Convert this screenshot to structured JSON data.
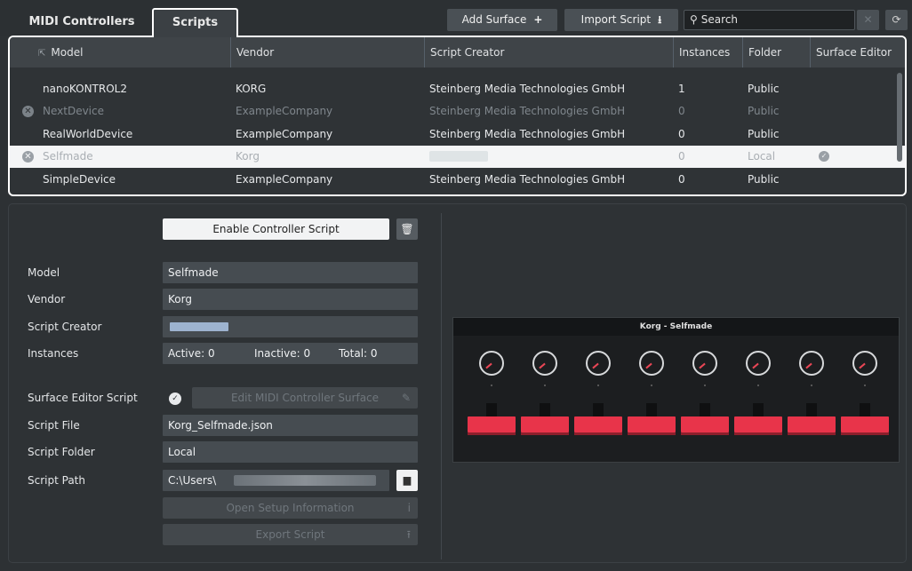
{
  "tabs": [
    {
      "label": "MIDI Controllers",
      "active": false
    },
    {
      "label": "Scripts",
      "active": true
    }
  ],
  "toolbar": {
    "add_surface": "Add Surface",
    "add_surface_icon": "+",
    "import_script": "Import Script",
    "search_placeholder": "Search"
  },
  "table": {
    "columns": [
      "Model",
      "Vendor",
      "Script Creator",
      "Instances",
      "Folder",
      "Surface Editor"
    ],
    "rows": [
      {
        "model": "nanoKONTROL2",
        "vendor": "KORG",
        "creator": "Steinberg Media Technologies GmbH",
        "instances": "1",
        "folder": "Public",
        "state": "normal"
      },
      {
        "model": "NextDevice",
        "vendor": "ExampleCompany",
        "creator": "Steinberg Media Technologies GmbH",
        "instances": "0",
        "folder": "Public",
        "state": "dim"
      },
      {
        "model": "RealWorldDevice",
        "vendor": "ExampleCompany",
        "creator": "Steinberg Media Technologies GmbH",
        "instances": "0",
        "folder": "Public",
        "state": "normal"
      },
      {
        "model": "Selfmade",
        "vendor": "Korg",
        "creator": "",
        "instances": "0",
        "folder": "Local",
        "state": "selected"
      },
      {
        "model": "SimpleDevice",
        "vendor": "ExampleCompany",
        "creator": "Steinberg Media Technologies GmbH",
        "instances": "0",
        "folder": "Public",
        "state": "normal"
      }
    ]
  },
  "details": {
    "enable_button": "Enable Controller Script",
    "model_label": "Model",
    "model_value": "Selfmade",
    "vendor_label": "Vendor",
    "vendor_value": "Korg",
    "creator_label": "Script Creator",
    "instances_label": "Instances",
    "active": "Active: 0",
    "inactive": "Inactive: 0",
    "total": "Total: 0",
    "surface_editor_label": "Surface Editor Script",
    "edit_surface_button": "Edit MIDI Controller Surface",
    "file_label": "Script File",
    "file_value": "Korg_Selfmade.json",
    "folder_label": "Script Folder",
    "folder_value": "Local",
    "path_label": "Script Path",
    "path_value": "C:\\Users\\",
    "open_setup_button": "Open Setup Information",
    "export_button": "Export Script"
  },
  "surface_preview": {
    "title": "Korg - Selfmade",
    "knob_count": 8,
    "fader_count": 8,
    "fader_color": "#e8344a"
  },
  "colors": {
    "background": "#2d3134",
    "accent_red": "#e8344a",
    "selected_row": "#f4f5f6"
  }
}
